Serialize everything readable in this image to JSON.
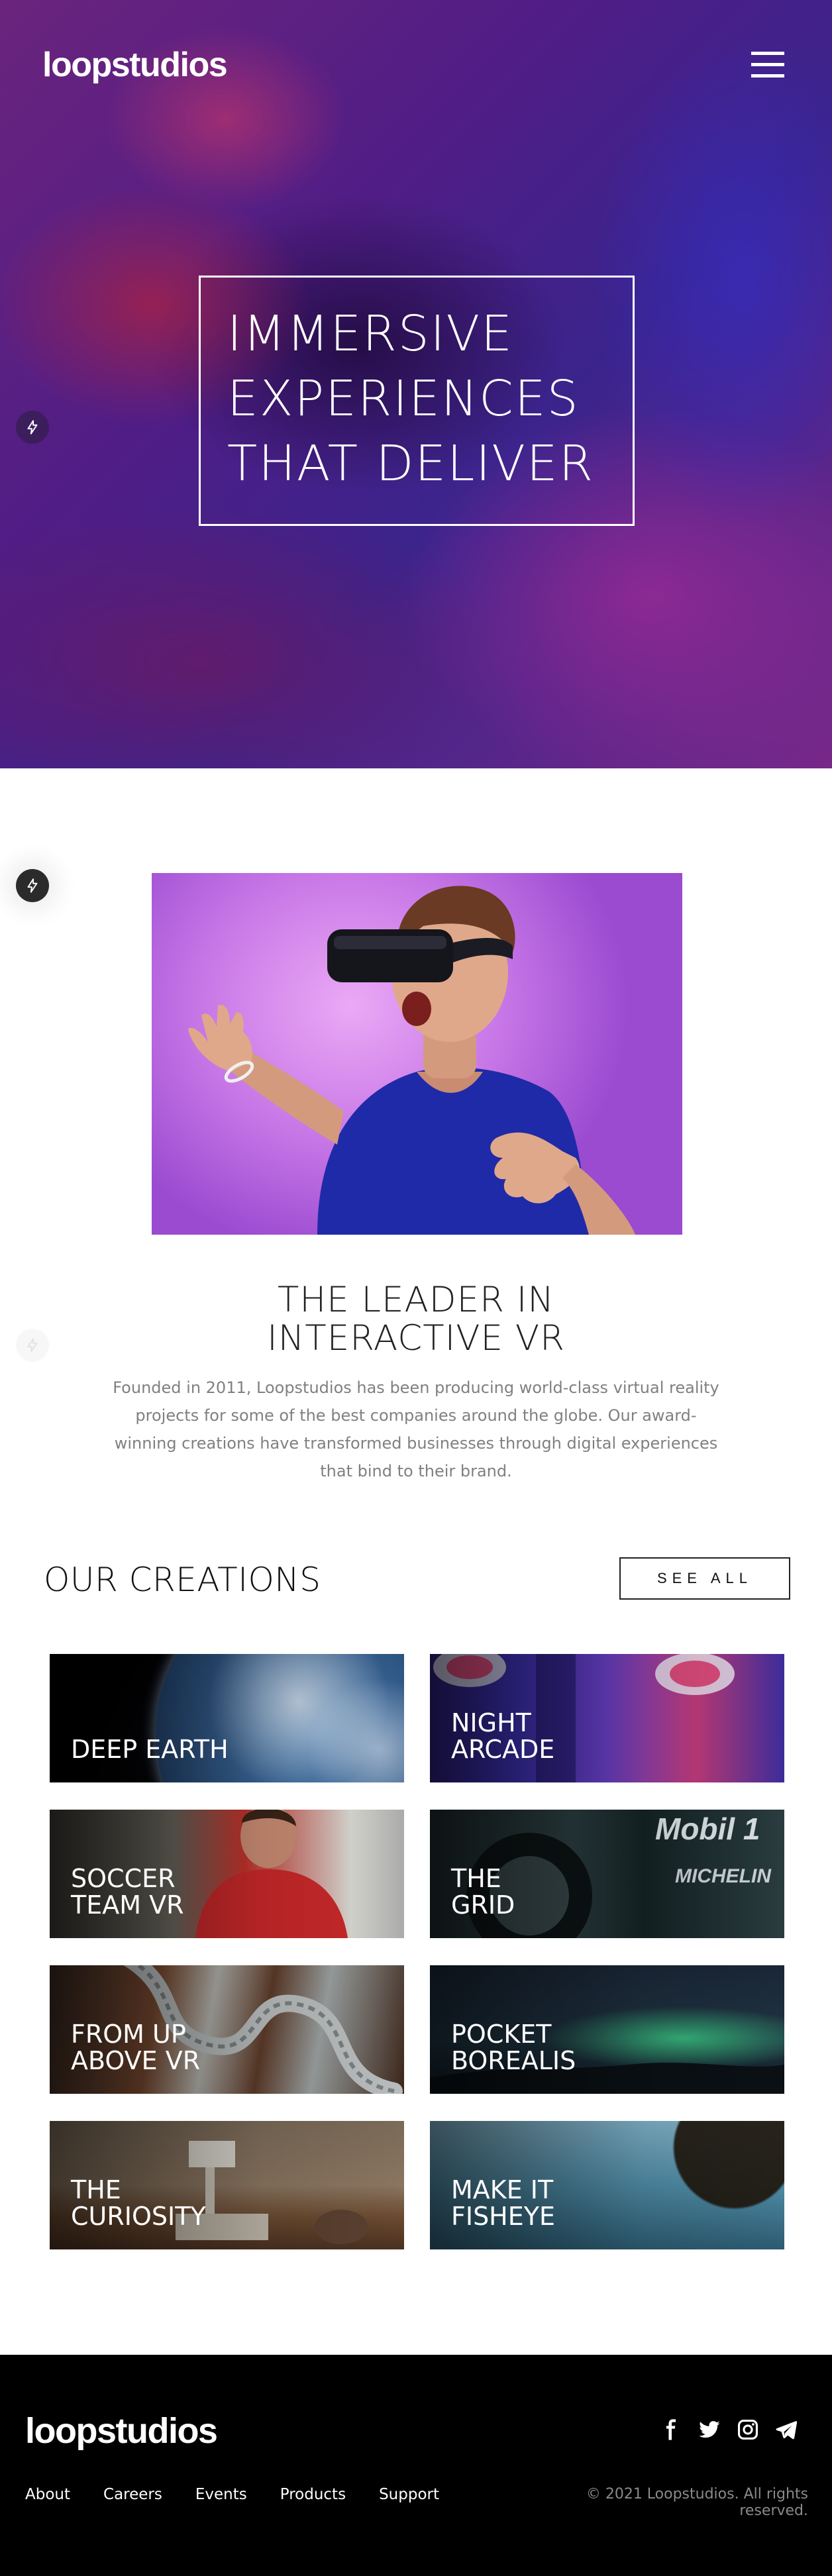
{
  "header": {
    "logo": "loopstudios",
    "menu_icon": "hamburger-menu-icon"
  },
  "hero": {
    "title_lines": [
      "IMMERSIVE",
      "EXPERIENCES",
      "THAT DELIVER"
    ]
  },
  "interactive": {
    "title_lines": [
      "THE LEADER IN",
      "INTERACTIVE VR"
    ],
    "text": "Founded in 2011, Loopstudios has been producing world-class virtual reality projects for some of the best companies around the globe. Our award-winning creations have transformed businesses through digital experiences that bind to their brand."
  },
  "creations": {
    "title": "OUR CREATIONS",
    "see_all": "SEE ALL",
    "items": [
      {
        "label": "DEEP EARTH"
      },
      {
        "label": "NIGHT\nARCADE"
      },
      {
        "label": "SOCCER\nTEAM VR"
      },
      {
        "label": "THE\nGRID"
      },
      {
        "label": "FROM UP\nABOVE VR"
      },
      {
        "label": "POCKET\nBOREALIS"
      },
      {
        "label": "THE\nCURIOSITY"
      },
      {
        "label": "MAKE IT\nFISHEYE"
      }
    ]
  },
  "footer": {
    "logo": "loopstudios",
    "nav": [
      "About",
      "Careers",
      "Events",
      "Products",
      "Support"
    ],
    "social_icons": [
      "facebook-icon",
      "twitter-icon",
      "instagram-icon",
      "telegram-icon"
    ],
    "copyright": "© 2021 Loopstudios. All rights reserved."
  },
  "colors": {
    "footer_bg": "#000000",
    "text_gray": "#808080",
    "white": "#ffffff"
  }
}
